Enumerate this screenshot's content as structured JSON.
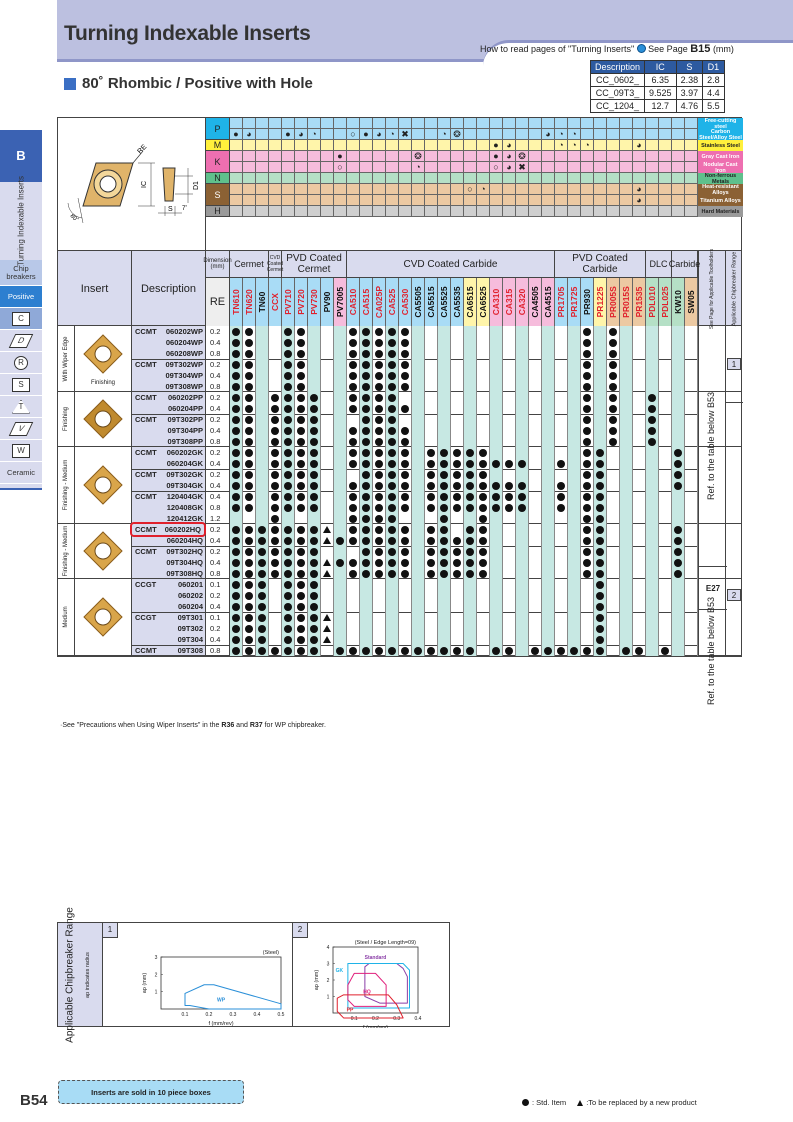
{
  "header": {
    "title": "Turning Indexable Inserts",
    "howto_text": "How to read pages of \"Turning Inserts\"",
    "see_page_prefix": "See Page",
    "see_page": "B15",
    "unit": "(mm)",
    "section_title": "80˚ Rhombic / Positive with Hole"
  },
  "dims_table": {
    "headers": [
      "Description",
      "IC",
      "S",
      "D1"
    ],
    "rows": [
      [
        "CC_0602_",
        "6.35",
        "2.38",
        "2.8"
      ],
      [
        "CC_09T3_",
        "9.525",
        "3.97",
        "4.4"
      ],
      [
        "CC_1204_",
        "12.7",
        "4.76",
        "5.5"
      ]
    ]
  },
  "sidebar": {
    "section_letter": "B",
    "vertical_label": "Turning Indexable Inserts",
    "chip_breakers": "Chip breakers",
    "positive": "Positive",
    "shapes": [
      "C",
      "D",
      "R",
      "S",
      "T",
      "V",
      "W"
    ],
    "ceramic": "Ceramic"
  },
  "diagram": {
    "labels": [
      "RE",
      "IC",
      "D1",
      "S",
      "80˚",
      "7˚"
    ]
  },
  "materials": [
    {
      "code": "P",
      "color": "#1fb3e8",
      "cell": "#a9dcf6",
      "rows": [
        {
          "name": "Free-cutting steel",
          "marks": "...................................."
        },
        {
          "name": "Carbon Steel/Alloy Steel",
          "marks": "●◕..●◕◔..○●◕◔✖..◔❂......◕◔◔........."
        }
      ]
    },
    {
      "code": "M",
      "color": "#fff03c",
      "cell": "#fff5aa",
      "rows": [
        {
          "name": "Stainless Steel",
          "marks": "....................●◕...◔◔◔...◕...."
        }
      ]
    },
    {
      "code": "K",
      "color": "#ee6fb0",
      "cell": "#f6bcdc",
      "rows": [
        {
          "name": "Gray Cast Iron",
          "marks": "........●.....❂.....●◕❂............."
        },
        {
          "name": "Nodular Cast Iron",
          "marks": "........○.....◔.....○◕✖............."
        }
      ]
    },
    {
      "code": "N",
      "color": "#5fc08c",
      "cell": "#b5e0c6",
      "rows": [
        {
          "name": "Non-ferrous Metals",
          "marks": "...................................."
        }
      ]
    },
    {
      "code": "S",
      "color": "#8b6134",
      "cell": "#ecc9a2",
      "rows": [
        {
          "name": "Heat-resistant Alloys",
          "marks": "..................○◔...........◕...."
        },
        {
          "name": "Titanium Alloys",
          "marks": "...............................◕...."
        }
      ]
    },
    {
      "code": "H",
      "color": "#9a9a9a",
      "cell": "#cfcfcf",
      "rows": [
        {
          "name": "Hard Materials",
          "marks": "...................................."
        }
      ]
    }
  ],
  "table_header": {
    "insert": "Insert",
    "description": "Description",
    "dimension": "Dimension (mm)",
    "re": "RE",
    "groups": [
      {
        "label": "Cermet",
        "span": 3
      },
      {
        "label": "CVD Coated Cermet",
        "span": 1
      },
      {
        "label": "PVD Coated Cermet",
        "span": 5
      },
      {
        "label": "CVD Coated Carbide",
        "span": 16
      },
      {
        "label": "PVD Coated Carbide",
        "span": 7
      },
      {
        "label": "DLC",
        "span": 2
      },
      {
        "label": "Carbide",
        "span": 2
      }
    ],
    "see_page_label": "See Page for Applicable Toolholders",
    "chipbreaker_label": "Applicable Chipbreaker Range",
    "grades": [
      {
        "name": "TN610",
        "color": "#e0202c",
        "bg": "#a9dcf6"
      },
      {
        "name": "TN620",
        "color": "#e0202c",
        "bg": "#a9dcf6"
      },
      {
        "name": "TN60",
        "color": "#111111",
        "bg": "#a9dcf6"
      },
      {
        "name": "CCX",
        "color": "#e0202c",
        "bg": "#a9dcf6"
      },
      {
        "name": "PV710",
        "color": "#e0202c",
        "bg": "#a9dcf6"
      },
      {
        "name": "PV720",
        "color": "#e0202c",
        "bg": "#a9dcf6"
      },
      {
        "name": "PV730",
        "color": "#e0202c",
        "bg": "#a9dcf6"
      },
      {
        "name": "PV90",
        "color": "#111111",
        "bg": "#a9dcf6"
      },
      {
        "name": "PV7005",
        "color": "#111111",
        "bg": "#f6bcdc"
      },
      {
        "name": "CA510",
        "color": "#e0202c",
        "bg": "#a9dcf6"
      },
      {
        "name": "CA515",
        "color": "#e0202c",
        "bg": "#a9dcf6"
      },
      {
        "name": "CA025P",
        "color": "#e0202c",
        "bg": "#a9dcf6"
      },
      {
        "name": "CA525",
        "color": "#e0202c",
        "bg": "#a9dcf6"
      },
      {
        "name": "CA530",
        "color": "#e0202c",
        "bg": "#a9dcf6"
      },
      {
        "name": "CA5505",
        "color": "#111111",
        "bg": "#a9dcf6"
      },
      {
        "name": "CA5515",
        "color": "#111111",
        "bg": "#a9dcf6"
      },
      {
        "name": "CA5525",
        "color": "#111111",
        "bg": "#a9dcf6"
      },
      {
        "name": "CA5535",
        "color": "#111111",
        "bg": "#a9dcf6"
      },
      {
        "name": "CA6515",
        "color": "#111111",
        "bg": "#fff5aa"
      },
      {
        "name": "CA6525",
        "color": "#111111",
        "bg": "#fff5aa"
      },
      {
        "name": "CA310",
        "color": "#e0202c",
        "bg": "#f6bcdc"
      },
      {
        "name": "CA315",
        "color": "#e0202c",
        "bg": "#f6bcdc"
      },
      {
        "name": "CA320",
        "color": "#e0202c",
        "bg": "#f6bcdc"
      },
      {
        "name": "CA4505",
        "color": "#111111",
        "bg": "#f6bcdc"
      },
      {
        "name": "CA4515",
        "color": "#111111",
        "bg": "#f6bcdc"
      },
      {
        "name": "PR1705",
        "color": "#e0202c",
        "bg": "#a9dcf6"
      },
      {
        "name": "PR1725",
        "color": "#e0202c",
        "bg": "#a9dcf6"
      },
      {
        "name": "PR930",
        "color": "#111111",
        "bg": "#a9dcf6"
      },
      {
        "name": "PR1225",
        "color": "#e0202c",
        "bg": "#fff5aa"
      },
      {
        "name": "PR005S",
        "color": "#e0202c",
        "bg": "#ecc9a2"
      },
      {
        "name": "PR015S",
        "color": "#e0202c",
        "bg": "#ecc9a2"
      },
      {
        "name": "PR1535",
        "color": "#e0202c",
        "bg": "#ecc9a2"
      },
      {
        "name": "PDL010",
        "color": "#e0202c",
        "bg": "#b5e0c6"
      },
      {
        "name": "PDL025",
        "color": "#e0202c",
        "bg": "#b5e0c6"
      },
      {
        "name": "KW10",
        "color": "#111111",
        "bg": "#b5e0c6"
      },
      {
        "name": "SW05",
        "color": "#111111",
        "bg": "#ecc9a2"
      }
    ]
  },
  "groups": [
    {
      "category": "With Wiper Edge",
      "caption": "Finishing",
      "shape_color": "#d9a54a",
      "subgroups": [
        {
          "prefix": "CCMT",
          "rows": [
            {
              "code": "060202WP",
              "re": "0.2",
              "marks": "oo..oo...ooooo.............o.o......."
            },
            {
              "code": "060204WP",
              "re": "0.4",
              "marks": "oo..oo...ooooo.............o.o......."
            },
            {
              "code": "060208WP",
              "re": "0.8",
              "marks": "oo..oo...ooooo.............o.o......."
            }
          ]
        },
        {
          "prefix": "CCMT",
          "rows": [
            {
              "code": "09T302WP",
              "re": "0.2",
              "marks": "oo..oo...ooooo.............o.o......."
            },
            {
              "code": "09T304WP",
              "re": "0.4",
              "marks": "oo..oo...ooooo.............o.o......."
            },
            {
              "code": "09T308WP",
              "re": "0.8",
              "marks": "oo..oo...ooooo.............o.o......."
            }
          ]
        }
      ]
    },
    {
      "category": "Finishing",
      "caption": "",
      "shape_color": "#c08a2e",
      "subgroups": [
        {
          "prefix": "CCMT",
          "rows": [
            {
              "code": "060202PP",
              "re": "0.2",
              "marks": "oo.oooo..oooo..............o.o..o...."
            },
            {
              "code": "060204PP",
              "re": "0.4",
              "marks": "oo.oooo..ooooo.............o.o..o...."
            }
          ]
        },
        {
          "prefix": "CCMT",
          "rows": [
            {
              "code": "09T302PP",
              "re": "0.2",
              "marks": "oo.oooo...ooo..............o.o..o...."
            },
            {
              "code": "09T304PP",
              "re": "0.4",
              "marks": "oo.oooo..ooooo.............o.o..o...."
            },
            {
              "code": "09T308PP",
              "re": "0.8",
              "marks": "oo.oooo..ooooo.............o.o..o...."
            }
          ]
        }
      ]
    },
    {
      "category": "Finishing - Medium",
      "caption": "",
      "shape_color": "#d9a54a",
      "subgroups": [
        {
          "prefix": "CCMT",
          "rows": [
            {
              "code": "060202GK",
              "re": "0.2",
              "marks": "oo.oooo..ooooo.ooooo.......oo.....o.."
            },
            {
              "code": "060204GK",
              "re": "0.4",
              "marks": "oo.oooo..ooooo.oooooooo..o.oo.....o.."
            }
          ]
        },
        {
          "prefix": "CCMT",
          "rows": [
            {
              "code": "09T302GK",
              "re": "0.2",
              "marks": "oo.oooo...oooo.ooooo.......oo.....o.."
            },
            {
              "code": "09T304GK",
              "re": "0.4",
              "marks": "oo.oooo..ooooo.oooooooo..o.oo.....o.."
            }
          ]
        },
        {
          "prefix": "CCMT",
          "rows": [
            {
              "code": "120404GK",
              "re": "0.4",
              "marks": "oo.oooo..ooooo.oooooooo..o.oo........"
            },
            {
              "code": "120408GK",
              "re": "0.8",
              "marks": "oo.oooo..ooooo.oooooooo..o.oo........"
            },
            {
              "code": "120412GK",
              "re": "1.2",
              "marks": "...o.....oooo...o..o.......oo........"
            }
          ]
        }
      ]
    },
    {
      "category": "Finishing - Medium",
      "caption": "",
      "shape_color": "#d9a54a",
      "highlight_first": true,
      "subgroups": [
        {
          "prefix": "CCMT",
          "rows": [
            {
              "code": "060202HQ",
              "re": "0.2",
              "marks": "ooooooo^.ooooo.oo.oo.......oo.....o.."
            },
            {
              "code": "060204HQ",
              "re": "0.4",
              "marks": "ooooooo^oooooo.ooooo.......oo.....o.."
            }
          ]
        },
        {
          "prefix": "CCMT",
          "rows": [
            {
              "code": "09T302HQ",
              "re": "0.2",
              "marks": "ooooooo...oooo.ooooo.......oo.....o.."
            },
            {
              "code": "09T304HQ",
              "re": "0.4",
              "marks": "ooooooo^oooooo.ooooo.......oo.....o.."
            },
            {
              "code": "09T308HQ",
              "re": "0.8",
              "marks": "ooooooo^.ooooo.ooooo.......oo.....o.."
            }
          ]
        }
      ]
    },
    {
      "category": "Medium",
      "caption": "",
      "shape_color": "#d9a54a",
      "subgroups": [
        {
          "prefix": "CCGT",
          "rows": [
            {
              "code": "060201",
              "re": "0.1",
              "marks": "ooo.ooo.....................o........"
            },
            {
              "code": "060202",
              "re": "0.2",
              "marks": "ooo.ooo.....................o........"
            },
            {
              "code": "060204",
              "re": "0.4",
              "marks": "ooo.ooo.....................o........"
            }
          ]
        },
        {
          "prefix": "CCGT",
          "rows": [
            {
              "code": "09T301",
              "re": "0.1",
              "marks": "ooo.ooo^....................o........"
            },
            {
              "code": "09T302",
              "re": "0.2",
              "marks": "ooo.ooo^....................o........"
            },
            {
              "code": "09T304",
              "re": "0.4",
              "marks": "ooo.ooo^....................o........"
            }
          ]
        },
        {
          "prefix": "CCMT",
          "rows": [
            {
              "code": "09T308",
              "re": "0.8",
              "marks": "ooooooo.ooooooooooo.oo.oooooo.oo.o..o"
            }
          ]
        }
      ]
    }
  ],
  "refs": {
    "ref_b53": "Ref. to the table below B53",
    "e27": "E27",
    "box1": "1",
    "box2": "2"
  },
  "footnote": {
    "pre": "·See \"Precautions when Using Wiper Inserts\" in the ",
    "r36": "R36",
    "mid": " and ",
    "r37": "R37",
    "post": " for WP chipbreaker."
  },
  "chart_data": [
    {
      "type": "area",
      "id": "1",
      "title": "(Steel)",
      "xlabel": "f (mm/rev)",
      "ylabel": "ap (mm)",
      "xticks": [
        "0.1",
        "0.2",
        "0.3",
        "0.4",
        "0.5"
      ],
      "yticks": [
        "1",
        "2",
        "3"
      ],
      "xlim": [
        0,
        0.5
      ],
      "ylim": [
        0,
        3
      ],
      "series": [
        {
          "name": "WP",
          "color": "#2a8fd8",
          "points": [
            [
              0.1,
              0.2
            ],
            [
              0.1,
              0.9
            ],
            [
              0.18,
              1.4
            ],
            [
              0.22,
              1.4
            ],
            [
              0.5,
              0.3
            ],
            [
              0.5,
              0.0
            ],
            [
              0.2,
              0.0
            ],
            [
              0.12,
              0.2
            ]
          ]
        }
      ]
    },
    {
      "type": "area",
      "id": "2",
      "title": "(Steel / Edge Length=09)",
      "xlabel": "f (mm/rev)",
      "ylabel": "ap (mm)",
      "xticks": [
        "0.1",
        "0.2",
        "0.3",
        "0.4"
      ],
      "yticks": [
        "1",
        "2",
        "3",
        "4"
      ],
      "xlim": [
        0,
        0.4
      ],
      "ylim": [
        0,
        4
      ],
      "series": [
        {
          "name": "Standard",
          "color": "#8b3fa8",
          "points": [
            [
              0.15,
              1.0
            ],
            [
              0.15,
              2.8
            ],
            [
              0.17,
              3.0
            ],
            [
              0.3,
              3.0
            ],
            [
              0.33,
              2.7
            ],
            [
              0.35,
              2.2
            ],
            [
              0.35,
              0.6
            ],
            [
              0.22,
              0.6
            ],
            [
              0.15,
              1.0
            ]
          ]
        },
        {
          "name": "GK",
          "color": "#1fb3e8",
          "points": [
            [
              0.07,
              0.3
            ],
            [
              0.07,
              3.0
            ],
            [
              0.33,
              3.0
            ],
            [
              0.36,
              2.6
            ],
            [
              0.36,
              0.3
            ]
          ]
        },
        {
          "name": "HQ",
          "color": "#e0207c",
          "points": [
            [
              0.07,
              0.8
            ],
            [
              0.07,
              1.7
            ],
            [
              0.1,
              2.4
            ],
            [
              0.2,
              2.4
            ],
            [
              0.25,
              1.7
            ],
            [
              0.25,
              0.4
            ],
            [
              0.1,
              0.4
            ]
          ]
        },
        {
          "name": "PP",
          "color": "#e0202c",
          "points": [
            [
              0.02,
              0.1
            ],
            [
              0.02,
              0.9
            ],
            [
              0.05,
              1.1
            ],
            [
              0.26,
              1.1
            ],
            [
              0.3,
              0.5
            ],
            [
              0.33,
              -0.3
            ],
            [
              0.05,
              -0.3
            ]
          ]
        }
      ]
    }
  ],
  "charts": {
    "range_label": "Applicable Chipbreaker Range",
    "sub_label": "ap indicates radius"
  },
  "footer": {
    "page": "B54",
    "box_note": "Inserts are sold in 10 piece boxes",
    "legend_std": ": Std. Item",
    "legend_tri": ":To be replaced by a new product"
  }
}
